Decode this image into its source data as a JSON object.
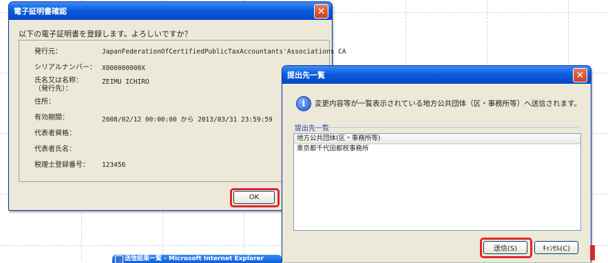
{
  "cert_dialog": {
    "title": "電子証明書確認",
    "message": "以下の電子証明書を登録します。よろしいですか？",
    "fields": [
      {
        "label": "発行元：",
        "value": "JapanFederationOfCertifiedPublicTaxAccountants'Associations CA"
      },
      {
        "label": "シリアルナンバー：",
        "value": "X000000000X"
      },
      {
        "label": "氏名又は名称：\n（発行先）：",
        "value": "ZEIMU ICHIRO"
      },
      {
        "label": "住所：",
        "value": ""
      },
      {
        "label": "有効期間：",
        "value": "2008/02/12 00:00:00 から 2013/03/31 23:59:59"
      },
      {
        "label": "代表者資格：",
        "value": ""
      },
      {
        "label": "代表者氏名：",
        "value": ""
      },
      {
        "label": "税理士登録番号：",
        "value": "123456"
      }
    ],
    "ok_label": "OK"
  },
  "dest_dialog": {
    "title": "提出先一覧",
    "info_text": "変更内容等が一覧表示されている地方公共団体（区・事務所等）へ送信されます。",
    "group_label": "提出先一覧",
    "list_header": "地方公共団体(区・事務所等)",
    "list_rows": [
      "東京都千代田都税事務所"
    ],
    "send_label": "送信(S)",
    "cancel_label": "ｷｬﾝｾﾙ(C)"
  },
  "ie_window": {
    "title": "送信結果一覧 - Microsoft Internet Explorer"
  },
  "colors": {
    "titlebar": "#0a5ddd",
    "highlight": "#e0252b",
    "dialog_bg": "#ece9d8"
  },
  "icons": {
    "close": "close-icon",
    "info": "info-icon"
  }
}
